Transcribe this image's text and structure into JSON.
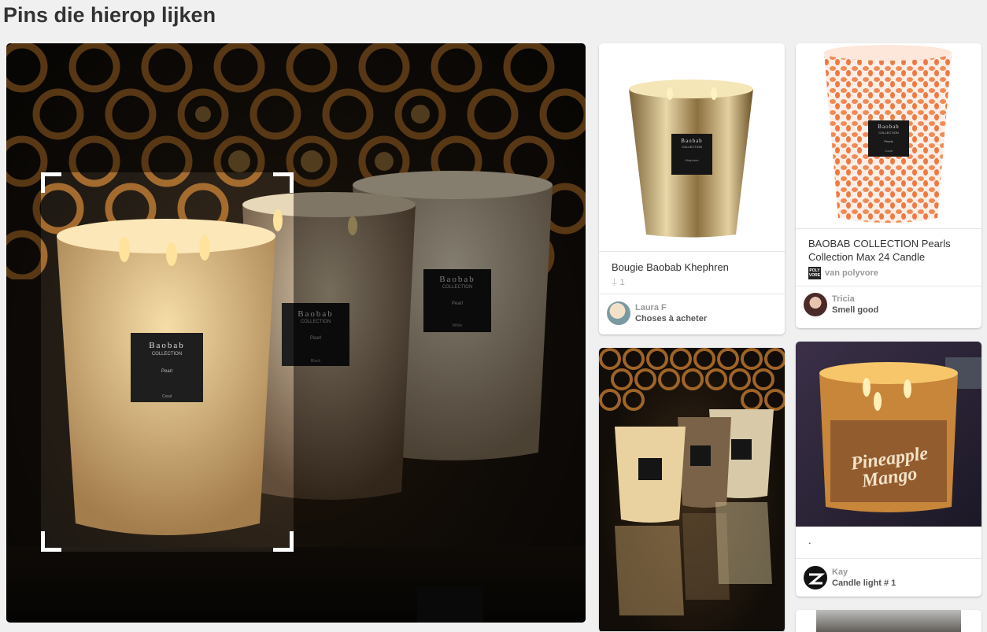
{
  "section": {
    "title": "Pins die hierop lijken"
  },
  "hero": {
    "candles": [
      {
        "brand": "Baobab",
        "collection": "COLLECTION",
        "variant": "Pearl",
        "sub": "Coral"
      },
      {
        "brand": "Baobab",
        "collection": "COLLECTION",
        "variant": "Pearl",
        "sub": "Black"
      },
      {
        "brand": "Baobab",
        "collection": "COLLECTION",
        "variant": "Pearl",
        "sub": "White"
      }
    ]
  },
  "pins": [
    {
      "description": "Bougie Baobab Khephren",
      "repins": "1",
      "user": "Laura F",
      "board": "Choses à acheter",
      "label": {
        "brand": "Baobab",
        "collection": "COLLECTION",
        "variant": "Khephren"
      }
    },
    {
      "description": "BAOBAB COLLECTION Pearls Collection Max 24 Candle",
      "source": "van polyvore",
      "source_logo": "POLY VORE",
      "user": "Tricia",
      "board": "Smell good",
      "label": {
        "brand": "Baobab",
        "collection": "COLLECTION",
        "variant": "Pearls",
        "sub": "Coral"
      }
    },
    {
      "description": ""
    },
    {
      "description": ".",
      "user": "Kay",
      "board": "Candle light # 1",
      "overlay_line1": "Pineapple",
      "overlay_line2": "Mango"
    }
  ],
  "colors": {
    "accent": "#333333",
    "candle_glow": "#f7c56a",
    "coral": "#f28a55"
  }
}
